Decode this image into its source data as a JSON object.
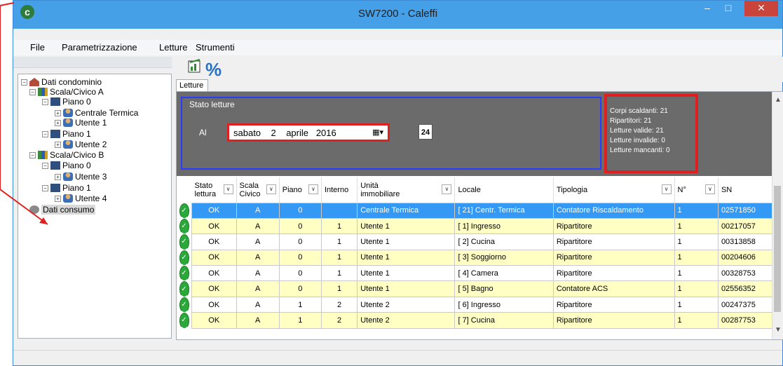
{
  "window": {
    "title": "SW7200 - Caleffi",
    "app_icon": "caleffi-logo-icon",
    "minimize": "minimize-icon",
    "maximize": "maximize-icon",
    "close": "close-icon"
  },
  "menu": {
    "items": [
      "File",
      "Parametrizzazione",
      "Letture",
      "Strumenti"
    ]
  },
  "toolbar": {
    "percent_label": "%"
  },
  "tree": {
    "root": "Dati condominio",
    "scala_a": "Scala/Civico A",
    "piano_a0": "Piano  0",
    "centrale": "Centrale Termica",
    "utente1": "Utente 1",
    "piano_a1": "Piano  1",
    "utente2": "Utente 2",
    "scala_b": "Scala/Civico B",
    "piano_b0": "Piano  0",
    "utente3": "Utente 3",
    "piano_b1": "Piano  1",
    "utente4": "Utente 4",
    "consumo": "Dati consumo"
  },
  "tab": {
    "label": "Letture"
  },
  "stato": {
    "title": "Stato letture",
    "al_label": "Al",
    "date": {
      "weekday": "sabato",
      "day": "2",
      "month": "aprile",
      "year": "2016"
    },
    "calendar_day": "24"
  },
  "stats": {
    "lines": [
      "Corpi scaldanti: 21",
      "Ripartitori: 21",
      "Letture valide: 21",
      "Letture invalide: 0",
      "Letture mancanti: 0"
    ]
  },
  "grid": {
    "columns": [
      "Stato lettura",
      "Scala Civico",
      "Piano",
      "Interno",
      "Unità immobiliare",
      "Locale",
      "Tipologia",
      "N°",
      "SN"
    ],
    "rows": [
      [
        "OK",
        "A",
        "0",
        "",
        "Centrale Termica",
        "[ 21] Centr. Termica",
        "Contatore Riscaldamento",
        "1",
        "02571850"
      ],
      [
        "OK",
        "A",
        "0",
        "1",
        "Utente 1",
        "[ 1] Ingresso",
        "Ripartitore",
        "1",
        "00217057"
      ],
      [
        "OK",
        "A",
        "0",
        "1",
        "Utente 1",
        "[ 2] Cucina",
        "Ripartitore",
        "1",
        "00313858"
      ],
      [
        "OK",
        "A",
        "0",
        "1",
        "Utente 1",
        "[ 3] Soggiorno",
        "Ripartitore",
        "1",
        "00204606"
      ],
      [
        "OK",
        "A",
        "0",
        "1",
        "Utente 1",
        "[ 4] Camera",
        "Ripartitore",
        "1",
        "00328753"
      ],
      [
        "OK",
        "A",
        "0",
        "1",
        "Utente 1",
        "[ 5] Bagno",
        "Contatore ACS",
        "1",
        "02556352"
      ],
      [
        "OK",
        "A",
        "1",
        "2",
        "Utente 2",
        "[ 6] Ingresso",
        "Ripartitore",
        "1",
        "00247375"
      ],
      [
        "OK",
        "A",
        "1",
        "2",
        "Utente 2",
        "[ 7] Cucina",
        "Ripartitore",
        "1",
        "00287753"
      ]
    ],
    "row_styles": [
      "sel",
      "yellow",
      "white",
      "yellow",
      "white",
      "yellow",
      "white",
      "yellow"
    ]
  },
  "colors": {
    "highlight_red": "#e02020",
    "highlight_blue": "#2a3bff",
    "title_bar": "#46a0e8",
    "selected_row": "#3399f5",
    "alt_row": "#ffffc4"
  }
}
